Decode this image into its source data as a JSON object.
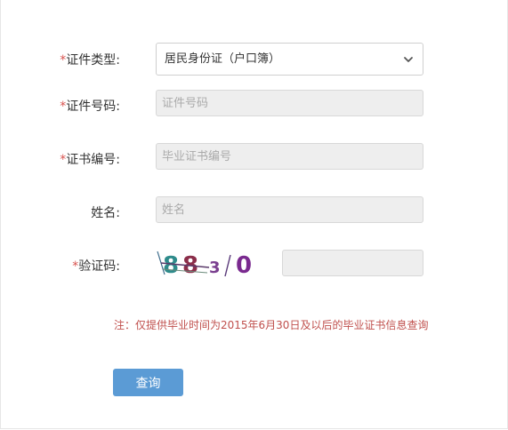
{
  "form": {
    "cert_type": {
      "required_mark": "*",
      "label": "证件类型:",
      "selected_value": "居民身份证（户口簿）",
      "icon": "chevron-down-icon"
    },
    "cert_number": {
      "required_mark": "*",
      "label": "证件号码:",
      "placeholder": "证件号码",
      "value": ""
    },
    "diploma_number": {
      "required_mark": "*",
      "label": "证书编号:",
      "placeholder": "毕业证书编号",
      "value": ""
    },
    "name": {
      "label": "姓名:",
      "placeholder": "姓名",
      "value": ""
    },
    "captcha": {
      "required_mark": "*",
      "label": "验证码:",
      "image_text": "88-30",
      "value": ""
    }
  },
  "note": "注：仅提供毕业时间为2015年6月30日及以后的毕业证书信息查询",
  "submit_label": "查询",
  "colors": {
    "required": "#d9534f",
    "note": "#c0504d",
    "button": "#5b9bd5"
  }
}
